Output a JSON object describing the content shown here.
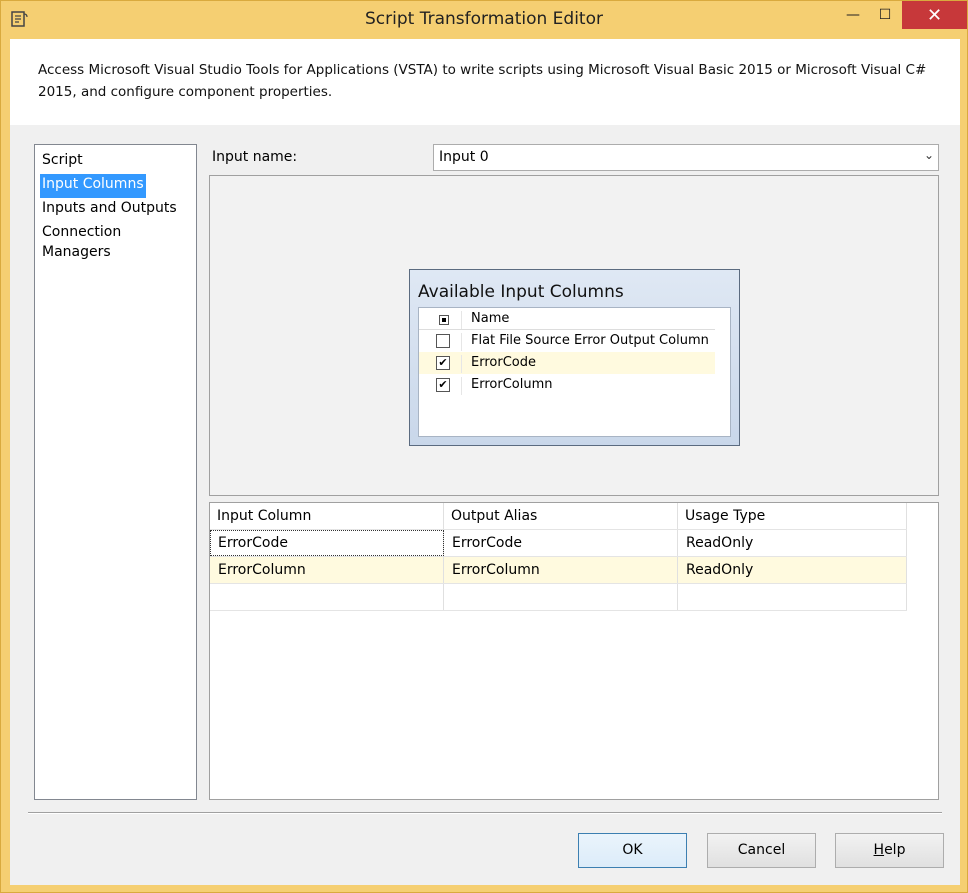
{
  "window": {
    "title": "Script Transformation Editor",
    "minimize_glyph": "—",
    "maximize_glyph": "☐",
    "close_glyph": "✕"
  },
  "header": {
    "description": "Access Microsoft Visual Studio Tools for Applications (VSTA) to write scripts using Microsoft Visual Basic 2015 or Microsoft Visual C# 2015, and configure component properties."
  },
  "nav": {
    "items": [
      {
        "label": "Script"
      },
      {
        "label": "Input Columns"
      },
      {
        "label": "Inputs and Outputs"
      },
      {
        "label": "Connection Managers"
      }
    ],
    "selected": "Input Columns"
  },
  "input_name": {
    "label": "Input name:",
    "value": "Input 0",
    "arrow_glyph": "⌄"
  },
  "available_columns": {
    "title": "Available Input Columns",
    "header": "Name",
    "check_glyph": "✔",
    "rows": [
      {
        "name": "Flat File Source Error Output Column",
        "checked": false
      },
      {
        "name": "ErrorCode",
        "checked": true
      },
      {
        "name": "ErrorColumn",
        "checked": true
      }
    ]
  },
  "mapping": {
    "columns": [
      "Input Column",
      "Output Alias",
      "Usage Type"
    ],
    "rows": [
      [
        "ErrorCode",
        "ErrorCode",
        "ReadOnly"
      ],
      [
        "ErrorColumn",
        "ErrorColumn",
        "ReadOnly"
      ],
      [
        "",
        "",
        ""
      ]
    ]
  },
  "buttons": {
    "ok": "OK",
    "cancel": "Cancel",
    "help_accel": "H",
    "help_rest": "elp"
  }
}
